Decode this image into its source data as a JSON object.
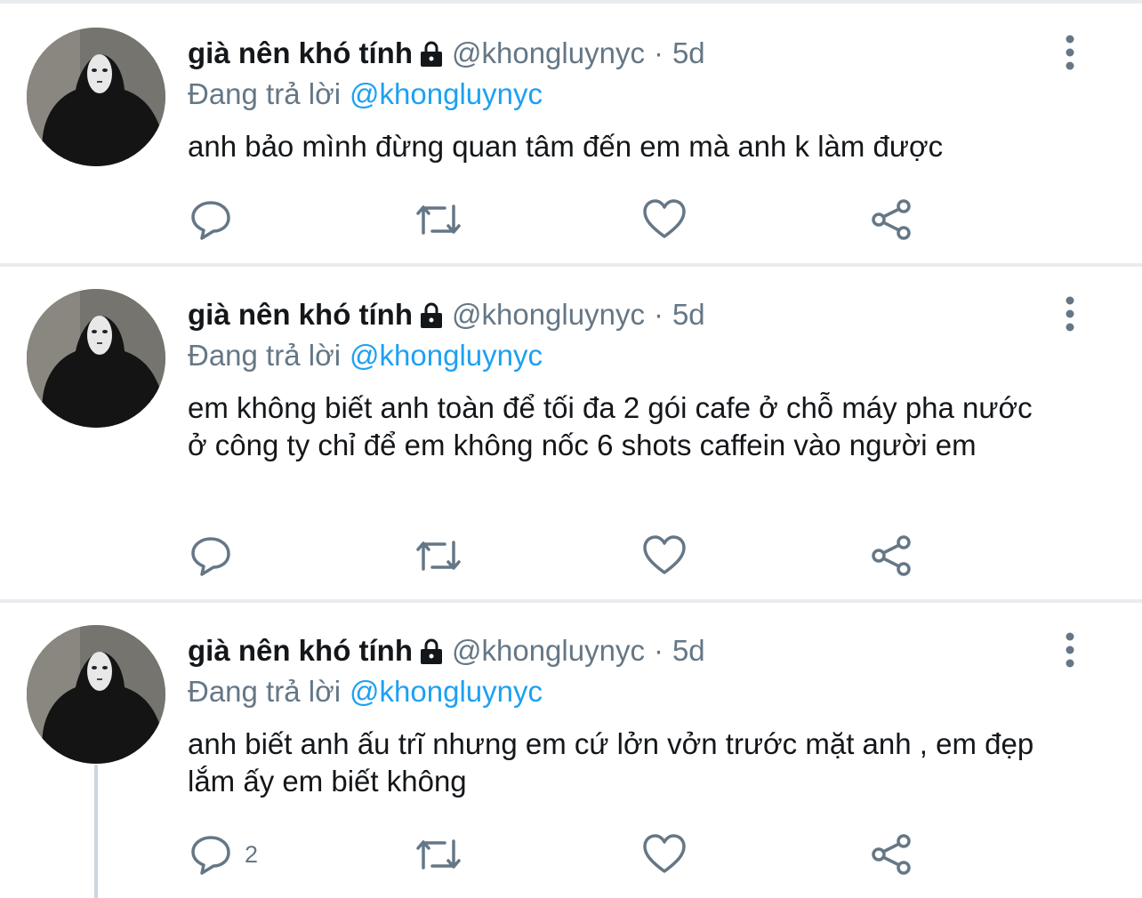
{
  "tweets": [
    {
      "name": "già nên khó tính",
      "handle": "@khongluynyc",
      "separator": "·",
      "time": "5d",
      "reply_prefix": "Đang trả lời",
      "reply_to": "@khongluynyc",
      "text": "anh bảo mình đừng quan tâm đến em mà anh k làm được",
      "reply_count": ""
    },
    {
      "name": "già nên khó tính",
      "handle": "@khongluynyc",
      "separator": "·",
      "time": "5d",
      "reply_prefix": "Đang trả lời",
      "reply_to": "@khongluynyc",
      "text": "em không biết anh toàn để tối đa 2 gói cafe ở chỗ máy pha nước ở công ty chỉ để em không nốc 6 shots caffein vào người em",
      "reply_count": ""
    },
    {
      "name": "già nên khó tính",
      "handle": "@khongluynyc",
      "separator": "·",
      "time": "5d",
      "reply_prefix": "Đang trả lời",
      "reply_to": "@khongluynyc",
      "text": "anh biết anh ấu trĩ nhưng em cứ lởn vởn trước mặt anh , em đẹp lắm ấy em biết không",
      "reply_count": "2"
    }
  ],
  "icons": {
    "lock": "lock-icon",
    "more": "more-vertical-icon",
    "reply": "reply-icon",
    "retweet": "retweet-icon",
    "like": "heart-icon",
    "share": "share-icon"
  },
  "colors": {
    "text": "#14171a",
    "secondary": "#657786",
    "mention": "#1da1f2",
    "divider": "#e9ecef",
    "thread_line": "#ccd6dd"
  }
}
